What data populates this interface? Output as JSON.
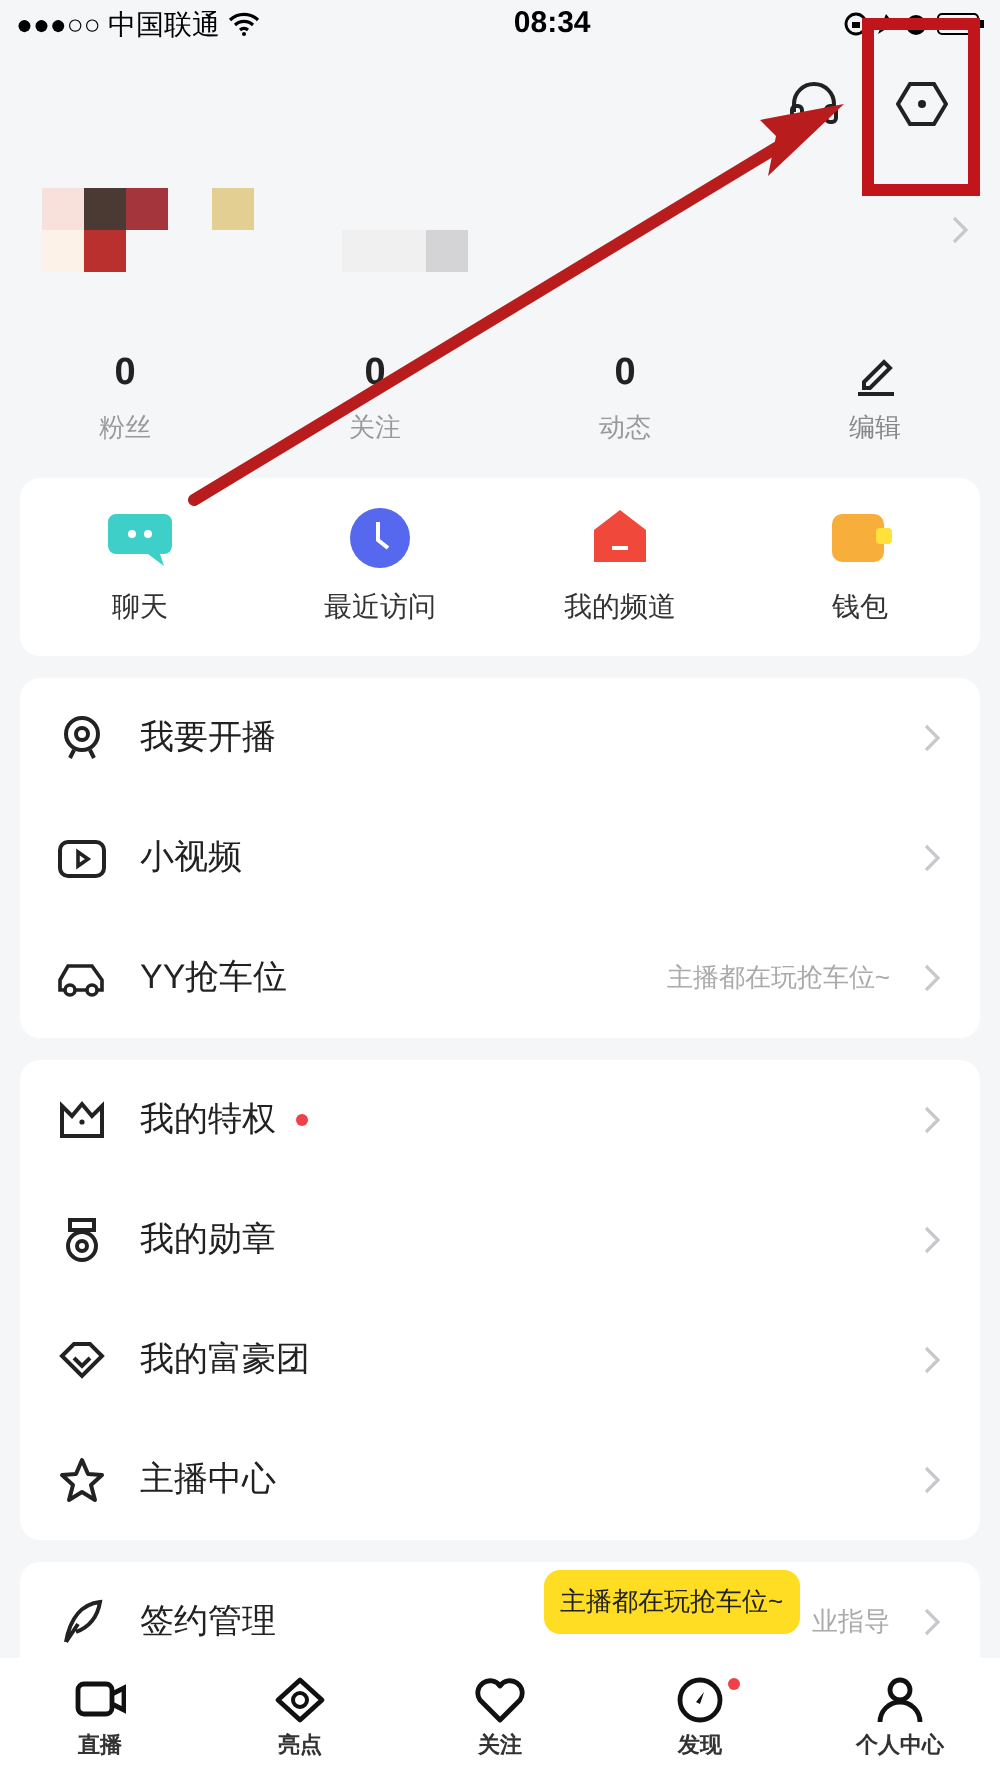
{
  "status_bar": {
    "carrier": "●●●○○ 中国联通",
    "time": "08:34"
  },
  "stats": [
    {
      "value": "0",
      "label": "粉丝"
    },
    {
      "value": "0",
      "label": "关注"
    },
    {
      "value": "0",
      "label": "动态"
    },
    {
      "kind": "edit",
      "label": "编辑"
    }
  ],
  "shortcuts": [
    {
      "kind": "chat",
      "label": "聊天"
    },
    {
      "kind": "clock",
      "label": "最近访问"
    },
    {
      "kind": "house",
      "label": "我的频道"
    },
    {
      "kind": "wallet",
      "label": "钱包"
    }
  ],
  "menu_groups": [
    {
      "items": [
        {
          "kind": "webcam",
          "label": "我要开播"
        },
        {
          "kind": "video",
          "label": "小视频"
        },
        {
          "kind": "car",
          "label": "YY抢车位",
          "hint": "主播都在玩抢车位~"
        }
      ]
    },
    {
      "items": [
        {
          "kind": "crown",
          "label": "我的特权",
          "dot": true
        },
        {
          "kind": "medal",
          "label": "我的勋章",
          "dot": false
        },
        {
          "kind": "diamond",
          "label": "我的富豪团",
          "dot": false
        },
        {
          "kind": "star",
          "label": "主播中心",
          "dot": false
        }
      ]
    },
    {
      "items": [
        {
          "kind": "feather",
          "label": "签约管理",
          "hint": "业指导"
        }
      ]
    }
  ],
  "tooltip": "主播都在玩抢车位~",
  "tab_bar": [
    {
      "kind": "camera",
      "label": "直播",
      "dot": false
    },
    {
      "kind": "eye",
      "label": "亮点",
      "dot": false
    },
    {
      "kind": "heart",
      "label": "关注",
      "dot": false
    },
    {
      "kind": "compass",
      "label": "发现",
      "dot": true
    },
    {
      "kind": "person",
      "label": "个人中心",
      "dot": false
    }
  ]
}
